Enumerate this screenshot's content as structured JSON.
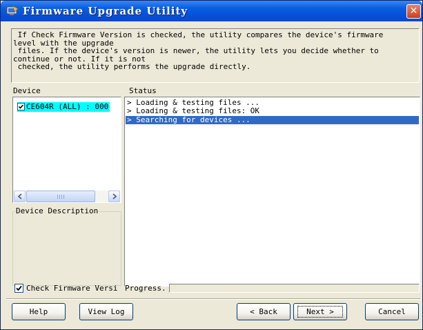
{
  "window": {
    "title": "Firmware Upgrade Utility",
    "close_symbol": "✕",
    "icon": "firmware-app-icon"
  },
  "description": {
    "lines": [
      " If Check Firmware Version is checked, the utility compares the device's firmware",
      "level with the upgrade",
      " files. If the device's version is newer, the utility lets you decide whether to",
      "continue or not. If it is not",
      " checked, the utility performs the upgrade directly."
    ]
  },
  "device_panel": {
    "label": "Device",
    "items": [
      {
        "label": "CE604R (ALL) : 000",
        "checked": true,
        "highlight": "#00ffff"
      }
    ]
  },
  "status_panel": {
    "label": "Status",
    "lines": [
      {
        "text": "> Loading & testing files ...",
        "selected": false
      },
      {
        "text": "> Loading & testing files: OK",
        "selected": false
      },
      {
        "text": "> Searching for devices ...",
        "selected": true
      }
    ]
  },
  "device_description": {
    "label": "Device Description",
    "text": ""
  },
  "options": {
    "check_firmware_label": "Check Firmware Versi",
    "check_firmware_checked": true,
    "progress_label": "Progress.",
    "progress_value": 0
  },
  "buttons": {
    "help": "Help",
    "view_log": "View Log",
    "back": "< Back",
    "next": "Next >",
    "cancel": "Cancel"
  },
  "colors": {
    "title_bar": "#0a5fe0",
    "selection": "#316ac5",
    "device_highlight": "#00ffff",
    "close_button": "#c9401e",
    "window_bg": "#ece9d8"
  }
}
